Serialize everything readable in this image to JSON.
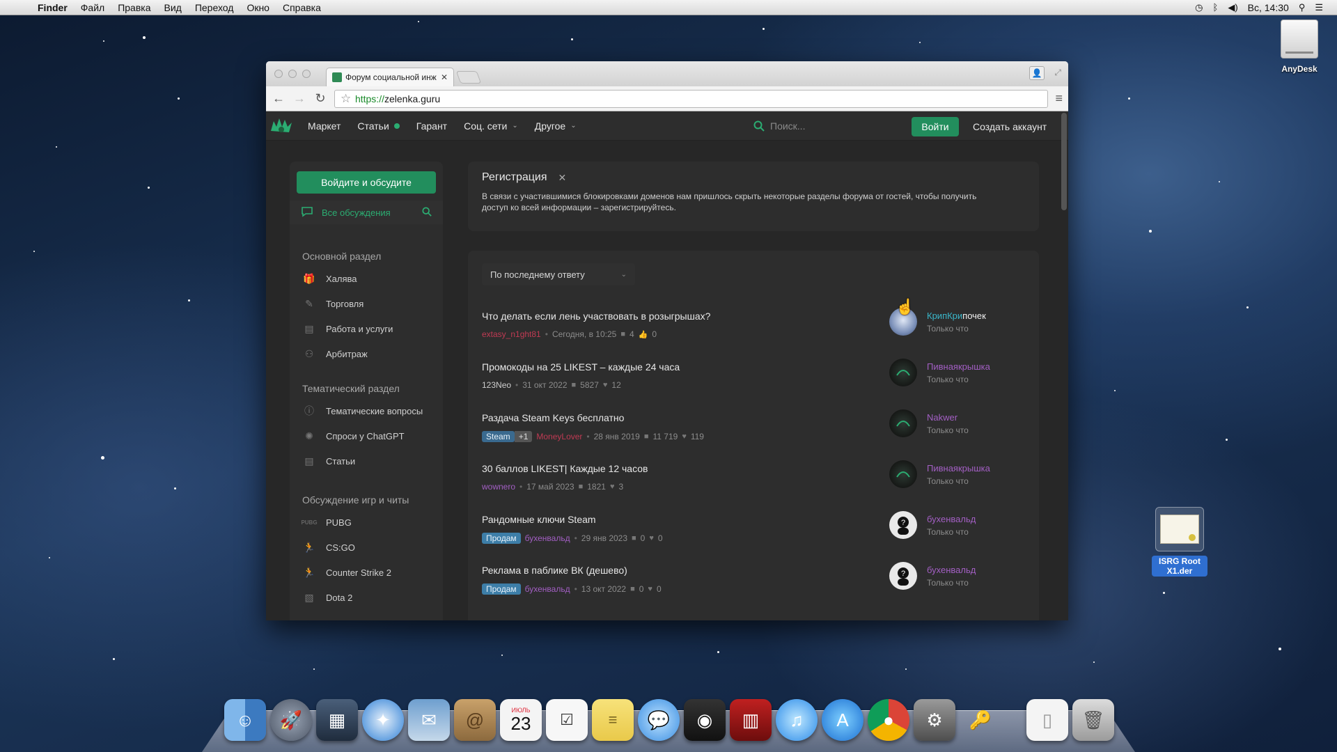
{
  "menubar": {
    "app": "Finder",
    "items": [
      "Файл",
      "Правка",
      "Вид",
      "Переход",
      "Окно",
      "Справка"
    ],
    "clock": "Вс, 14:30"
  },
  "desktop": {
    "anydesk_label": "AnyDesk",
    "cert_label": "ISRG Root X1.der"
  },
  "browser": {
    "tab_title": "Форум социальной инжене",
    "url_scheme": "https://",
    "url_rest": "zelenka.guru"
  },
  "site": {
    "nav": [
      {
        "label": "Маркет"
      },
      {
        "label": "Статьи"
      },
      {
        "label": "Гарант"
      },
      {
        "label": "Соц. сети"
      },
      {
        "label": "Другое"
      }
    ],
    "search_placeholder": "Поиск...",
    "login_label": "Войти",
    "signup_label": "Создать аккаунт",
    "sidebar": {
      "cta": "Войдите и обсудите",
      "all_discussions": "Все обсуждения",
      "section_main": "Основной раздел",
      "main_items": [
        "Халява",
        "Торговля",
        "Работа и услуги",
        "Арбитраж"
      ],
      "section_theme": "Тематический раздел",
      "theme_items": [
        "Тематические вопросы",
        "Спроси у ChatGPT",
        "Статьи"
      ],
      "section_games": "Обсуждение игр и читы",
      "game_items": [
        "PUBG",
        "CS:GO",
        "Counter Strike 2",
        "Dota 2"
      ],
      "pubg_badge": "PUBG"
    },
    "notice": {
      "title": "Регистрация",
      "text": "В связи с участившимися блокировками доменов нам пришлось скрыть некоторые разделы форума от гостей, чтобы получить доступ ко всей информации – зарегистрируйтесь."
    },
    "sort_label": "По последнему ответу",
    "threads": [
      {
        "title": "Что делать если лень участвовать в розыгрышах?",
        "author": "extasy_n1ght81",
        "date": "Сегодня, в 10:25",
        "replies": "4",
        "likes": "0",
        "last_user_a": "КрипКри",
        "last_user_b": "почек",
        "last_time": "Только что"
      },
      {
        "title": "Промокоды на 25 LIKEST – каждые 24 часа",
        "author": "123Neo",
        "date": "31 окт 2022",
        "replies": "5827",
        "likes": "12",
        "last_user": "Пивнаякрышка",
        "last_time": "Только что"
      },
      {
        "title": "Раздача Steam Keys бесплатно",
        "badge": "Steam",
        "badge_extra": "+1",
        "author": "MoneyLover",
        "date": "28 янв 2019",
        "replies": "11 719",
        "likes": "119",
        "last_user": "Nakwer",
        "last_time": "Только что"
      },
      {
        "title": "30 баллов LIKEST| Каждые 12 часов",
        "author": "wownero",
        "date": "17 май 2023",
        "replies": "1821",
        "likes": "3",
        "last_user": "Пивнаякрышка",
        "last_time": "Только что"
      },
      {
        "title": "Рандомные ключи Steam",
        "badge": "Продам",
        "author": "бухенвальд",
        "date": "29 янв 2023",
        "replies": "0",
        "likes": "0",
        "last_user": "бухенвальд",
        "last_time": "Только что"
      },
      {
        "title": "Реклама в паблике ВК (дешево)",
        "badge": "Продам",
        "author": "бухенвальд",
        "date": "13 окт 2022",
        "replies": "0",
        "likes": "0",
        "last_user": "бухенвальд",
        "last_time": "Только что"
      }
    ]
  },
  "dock": {
    "calendar_day": "23",
    "calendar_month": "ИЮЛЬ"
  }
}
